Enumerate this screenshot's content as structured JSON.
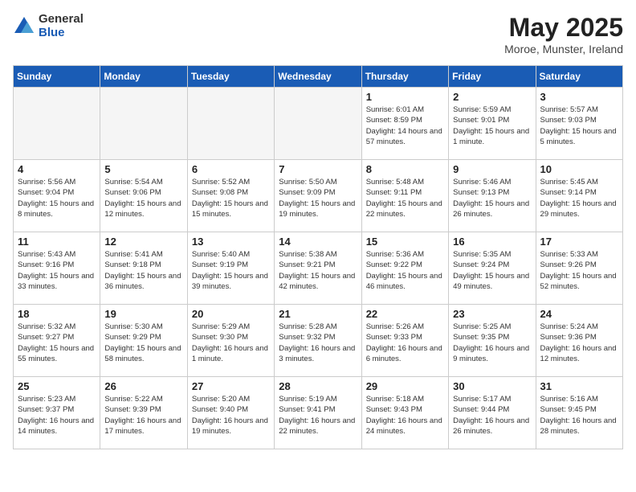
{
  "header": {
    "logo_general": "General",
    "logo_blue": "Blue",
    "title": "May 2025",
    "location": "Moroe, Munster, Ireland"
  },
  "weekdays": [
    "Sunday",
    "Monday",
    "Tuesday",
    "Wednesday",
    "Thursday",
    "Friday",
    "Saturday"
  ],
  "weeks": [
    [
      {
        "day": "",
        "info": ""
      },
      {
        "day": "",
        "info": ""
      },
      {
        "day": "",
        "info": ""
      },
      {
        "day": "",
        "info": ""
      },
      {
        "day": "1",
        "info": "Sunrise: 6:01 AM\nSunset: 8:59 PM\nDaylight: 14 hours\nand 57 minutes."
      },
      {
        "day": "2",
        "info": "Sunrise: 5:59 AM\nSunset: 9:01 PM\nDaylight: 15 hours\nand 1 minute."
      },
      {
        "day": "3",
        "info": "Sunrise: 5:57 AM\nSunset: 9:03 PM\nDaylight: 15 hours\nand 5 minutes."
      }
    ],
    [
      {
        "day": "4",
        "info": "Sunrise: 5:56 AM\nSunset: 9:04 PM\nDaylight: 15 hours\nand 8 minutes."
      },
      {
        "day": "5",
        "info": "Sunrise: 5:54 AM\nSunset: 9:06 PM\nDaylight: 15 hours\nand 12 minutes."
      },
      {
        "day": "6",
        "info": "Sunrise: 5:52 AM\nSunset: 9:08 PM\nDaylight: 15 hours\nand 15 minutes."
      },
      {
        "day": "7",
        "info": "Sunrise: 5:50 AM\nSunset: 9:09 PM\nDaylight: 15 hours\nand 19 minutes."
      },
      {
        "day": "8",
        "info": "Sunrise: 5:48 AM\nSunset: 9:11 PM\nDaylight: 15 hours\nand 22 minutes."
      },
      {
        "day": "9",
        "info": "Sunrise: 5:46 AM\nSunset: 9:13 PM\nDaylight: 15 hours\nand 26 minutes."
      },
      {
        "day": "10",
        "info": "Sunrise: 5:45 AM\nSunset: 9:14 PM\nDaylight: 15 hours\nand 29 minutes."
      }
    ],
    [
      {
        "day": "11",
        "info": "Sunrise: 5:43 AM\nSunset: 9:16 PM\nDaylight: 15 hours\nand 33 minutes."
      },
      {
        "day": "12",
        "info": "Sunrise: 5:41 AM\nSunset: 9:18 PM\nDaylight: 15 hours\nand 36 minutes."
      },
      {
        "day": "13",
        "info": "Sunrise: 5:40 AM\nSunset: 9:19 PM\nDaylight: 15 hours\nand 39 minutes."
      },
      {
        "day": "14",
        "info": "Sunrise: 5:38 AM\nSunset: 9:21 PM\nDaylight: 15 hours\nand 42 minutes."
      },
      {
        "day": "15",
        "info": "Sunrise: 5:36 AM\nSunset: 9:22 PM\nDaylight: 15 hours\nand 46 minutes."
      },
      {
        "day": "16",
        "info": "Sunrise: 5:35 AM\nSunset: 9:24 PM\nDaylight: 15 hours\nand 49 minutes."
      },
      {
        "day": "17",
        "info": "Sunrise: 5:33 AM\nSunset: 9:26 PM\nDaylight: 15 hours\nand 52 minutes."
      }
    ],
    [
      {
        "day": "18",
        "info": "Sunrise: 5:32 AM\nSunset: 9:27 PM\nDaylight: 15 hours\nand 55 minutes."
      },
      {
        "day": "19",
        "info": "Sunrise: 5:30 AM\nSunset: 9:29 PM\nDaylight: 15 hours\nand 58 minutes."
      },
      {
        "day": "20",
        "info": "Sunrise: 5:29 AM\nSunset: 9:30 PM\nDaylight: 16 hours\nand 1 minute."
      },
      {
        "day": "21",
        "info": "Sunrise: 5:28 AM\nSunset: 9:32 PM\nDaylight: 16 hours\nand 3 minutes."
      },
      {
        "day": "22",
        "info": "Sunrise: 5:26 AM\nSunset: 9:33 PM\nDaylight: 16 hours\nand 6 minutes."
      },
      {
        "day": "23",
        "info": "Sunrise: 5:25 AM\nSunset: 9:35 PM\nDaylight: 16 hours\nand 9 minutes."
      },
      {
        "day": "24",
        "info": "Sunrise: 5:24 AM\nSunset: 9:36 PM\nDaylight: 16 hours\nand 12 minutes."
      }
    ],
    [
      {
        "day": "25",
        "info": "Sunrise: 5:23 AM\nSunset: 9:37 PM\nDaylight: 16 hours\nand 14 minutes."
      },
      {
        "day": "26",
        "info": "Sunrise: 5:22 AM\nSunset: 9:39 PM\nDaylight: 16 hours\nand 17 minutes."
      },
      {
        "day": "27",
        "info": "Sunrise: 5:20 AM\nSunset: 9:40 PM\nDaylight: 16 hours\nand 19 minutes."
      },
      {
        "day": "28",
        "info": "Sunrise: 5:19 AM\nSunset: 9:41 PM\nDaylight: 16 hours\nand 22 minutes."
      },
      {
        "day": "29",
        "info": "Sunrise: 5:18 AM\nSunset: 9:43 PM\nDaylight: 16 hours\nand 24 minutes."
      },
      {
        "day": "30",
        "info": "Sunrise: 5:17 AM\nSunset: 9:44 PM\nDaylight: 16 hours\nand 26 minutes."
      },
      {
        "day": "31",
        "info": "Sunrise: 5:16 AM\nSunset: 9:45 PM\nDaylight: 16 hours\nand 28 minutes."
      }
    ]
  ]
}
